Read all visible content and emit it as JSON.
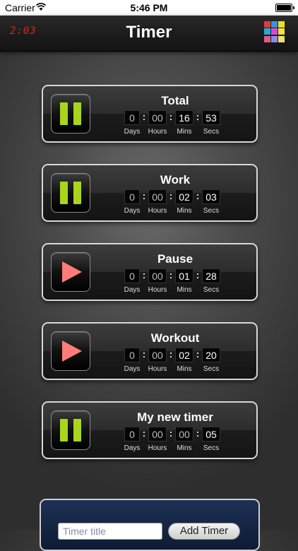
{
  "status_bar": {
    "carrier": "Carrier",
    "time": "5:46 PM"
  },
  "nav": {
    "clock": "2:03",
    "title": "Timer",
    "grid_colors": [
      "#e23b3b",
      "#3a8fe0",
      "#e8e02c",
      "#2aa8d8",
      "#d84ccc",
      "#f0e04a",
      "#e05a8a",
      "#8a8ae8",
      "#f0e070"
    ]
  },
  "units": {
    "days": "Days",
    "hours": "Hours",
    "mins": "Mins",
    "secs": "Secs"
  },
  "timers": [
    {
      "name": "Total",
      "state": "pause-icon",
      "days": "0",
      "hours": "00",
      "mins": "16",
      "secs": "53"
    },
    {
      "name": "Work",
      "state": "pause-icon",
      "days": "0",
      "hours": "00",
      "mins": "02",
      "secs": "03"
    },
    {
      "name": "Pause",
      "state": "play-icon",
      "days": "0",
      "hours": "00",
      "mins": "01",
      "secs": "28"
    },
    {
      "name": "Workout",
      "state": "play-icon",
      "days": "0",
      "hours": "00",
      "mins": "02",
      "secs": "20"
    },
    {
      "name": "My new timer",
      "state": "pause-icon",
      "days": "0",
      "hours": "00",
      "mins": "00",
      "secs": "05"
    }
  ],
  "add_panel": {
    "input_placeholder": "Timer title",
    "add_button": "Add Timer"
  }
}
